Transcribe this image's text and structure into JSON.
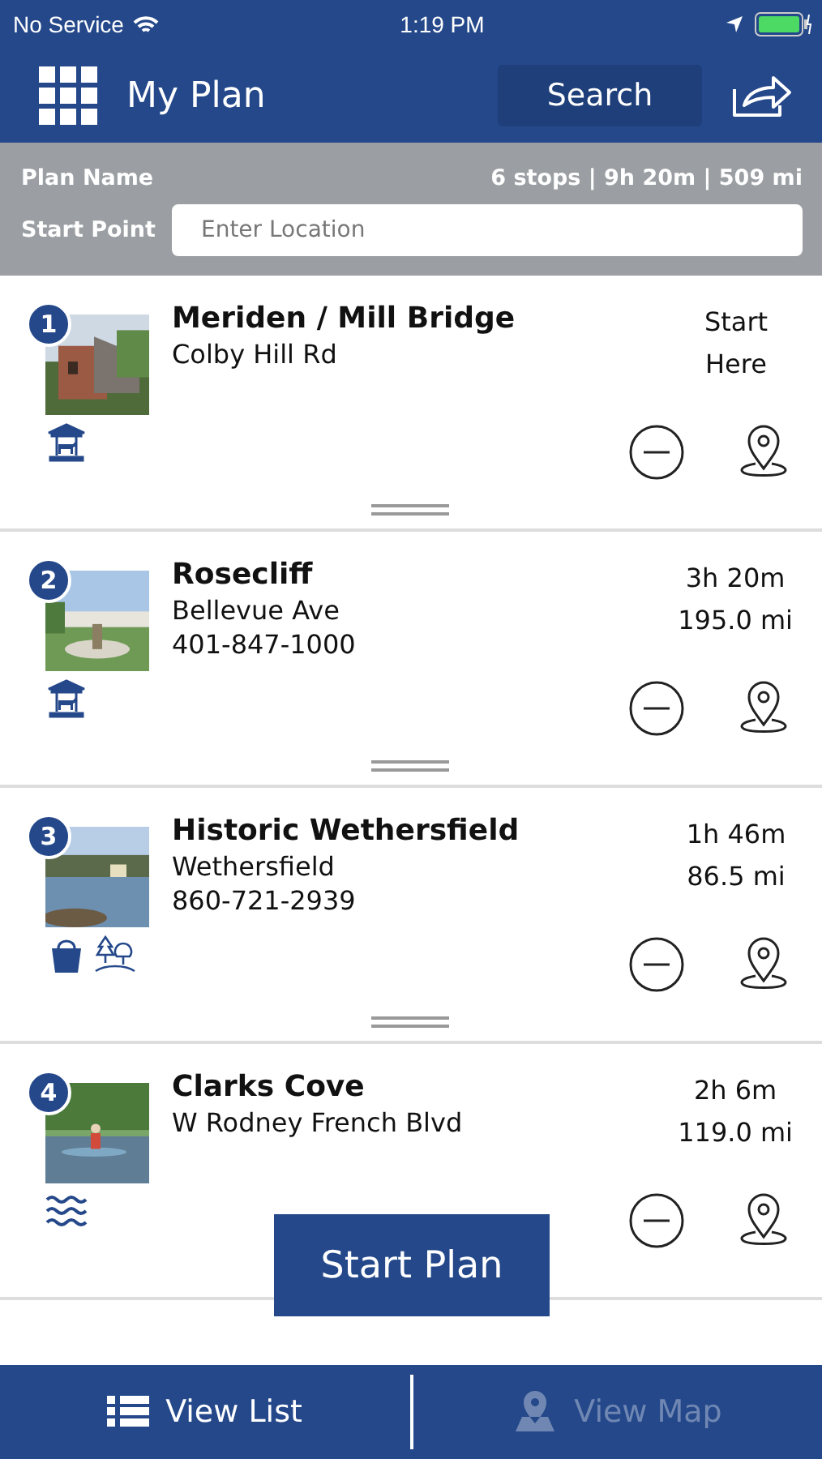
{
  "status_bar": {
    "carrier": "No Service",
    "time": "1:19 PM"
  },
  "header": {
    "title": "My Plan",
    "search_button": "Search"
  },
  "plan": {
    "name_label": "Plan Name",
    "summary": "6 stops | 9h 20m | 509 mi",
    "start_label": "Start Point",
    "start_placeholder": "Enter Location"
  },
  "stops": [
    {
      "number": "1",
      "name": "Meriden / Mill Bridge",
      "address": "Colby Hill Rd",
      "line_1": "Start",
      "line_2": "Here",
      "photo": {
        "kind": "picture"
      },
      "icons": [
        {
          "kind": "carousel"
        }
      ]
    },
    {
      "number": "2",
      "name": "Rosecliff",
      "address": "Bellevue Ave",
      "phone": "401-847-1000",
      "line_1": "3h 20m",
      "line_2": "195.0 mi",
      "photo": {
        "kind": "picture"
      },
      "icons": [
        {
          "kind": "carousel"
        }
      ]
    },
    {
      "number": "3",
      "name": "Historic Wethersfield",
      "address": "Wethersfield",
      "phone": "860-721-2939",
      "line_1": "1h 46m",
      "line_2": "86.5 mi",
      "photo": {
        "kind": "picture"
      },
      "icons": [
        {
          "kind": "bag"
        },
        {
          "kind": "trees"
        }
      ]
    },
    {
      "number": "4",
      "name": "Clarks Cove",
      "address": "W Rodney French Blvd",
      "line_1": "2h 6m",
      "line_2": "119.0 mi",
      "photo": {
        "kind": "picture"
      },
      "icons": [
        {
          "kind": "waves"
        }
      ]
    }
  ],
  "start_button": "Start Plan",
  "tabs": [
    {
      "label": "View List",
      "kind": "list",
      "selected": true
    },
    {
      "label": "View Map",
      "kind": "map",
      "selected": false
    }
  ]
}
